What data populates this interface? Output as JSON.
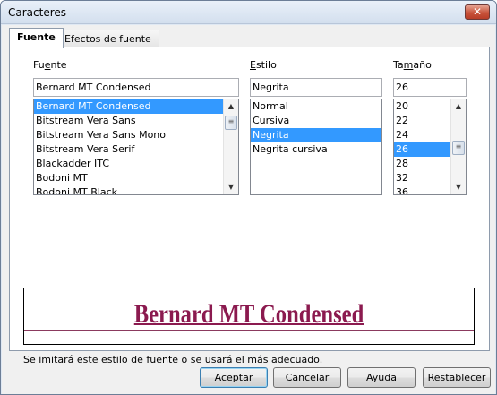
{
  "window": {
    "title": "Caracteres",
    "close_glyph": "✕"
  },
  "tabs": [
    {
      "label": "Fuente",
      "active": true
    },
    {
      "label": "Efectos de fuente",
      "active": false
    }
  ],
  "font": {
    "label_prefix": "Fu",
    "label_accel": "e",
    "label_suffix": "nte",
    "value": "Bernard MT Condensed",
    "items": [
      "Bernard MT Condensed",
      "Bitstream Vera Sans",
      "Bitstream Vera Sans Mono",
      "Bitstream Vera Serif",
      "Blackadder ITC",
      "Bodoni MT",
      "Bodoni MT Black"
    ],
    "selected_index": 0
  },
  "style": {
    "label_prefix": "",
    "label_accel": "E",
    "label_suffix": "stilo",
    "value": "Negrita",
    "items": [
      "Normal",
      "Cursiva",
      "Negrita",
      "Negrita cursiva"
    ],
    "selected_index": 2
  },
  "size": {
    "label_prefix": "Ta",
    "label_accel": "m",
    "label_suffix": "año",
    "value": "26",
    "items": [
      "20",
      "22",
      "24",
      "26",
      "28",
      "32",
      "36"
    ],
    "selected_index": 3
  },
  "preview": {
    "text": "Bernard MT Condensed",
    "color": "#8b1a4f"
  },
  "info_text": "Se imitará este estilo de fuente o se usará el más adecuado.",
  "buttons": {
    "ok": "Aceptar",
    "cancel": "Cancelar",
    "help": "Ayuda",
    "reset": "Restablecer"
  },
  "icons": {
    "scroll_up": "▲",
    "scroll_down": "▼",
    "thumb_grip": "≡"
  },
  "colors": {
    "selection": "#3399ff",
    "dialog_bg": "#f0f0f0"
  }
}
